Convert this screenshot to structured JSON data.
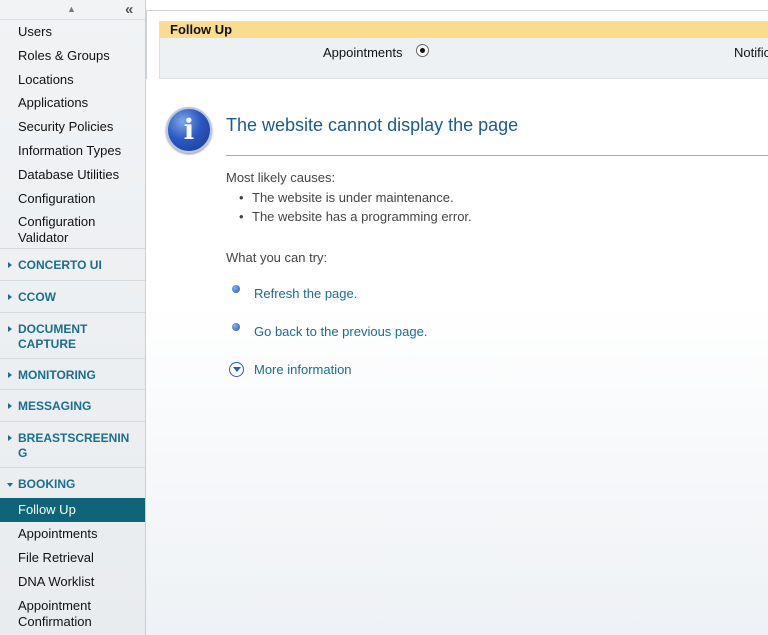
{
  "sidebar": {
    "items_top": [
      "Users",
      "Roles & Groups",
      "Locations",
      "Applications",
      "Security Policies",
      "Information Types",
      "Database Utilities",
      "Configuration"
    ],
    "config_validator": [
      "Configuration",
      "Validator"
    ],
    "sections": {
      "concerto": "CONCERTO UI",
      "ccow": "CCOW",
      "doc_capture": [
        "DOCUMENT",
        "CAPTURE"
      ],
      "monitoring": "MONITORING",
      "messaging": "MESSAGING",
      "breastscreening": [
        "BREASTSCREENIN",
        "G"
      ],
      "booking": "BOOKING"
    },
    "booking_items": [
      "Follow Up",
      "Appointments",
      "File Retrieval",
      "DNA Worklist"
    ],
    "appointment_confirmation": [
      "Appointment",
      "Confirmation"
    ],
    "active_item": "Follow Up"
  },
  "panel": {
    "title": "Follow Up",
    "option_1": "Appointments",
    "option_2": "Notific"
  },
  "error": {
    "title": "The website cannot display the page",
    "causes_heading": "Most likely causes:",
    "causes": [
      "The website is under maintenance.",
      "The website has a programming error."
    ],
    "try_heading": "What you can try:",
    "refresh": "Refresh the page.",
    "go_back": "Go back to the previous page.",
    "more_info": "More information"
  }
}
